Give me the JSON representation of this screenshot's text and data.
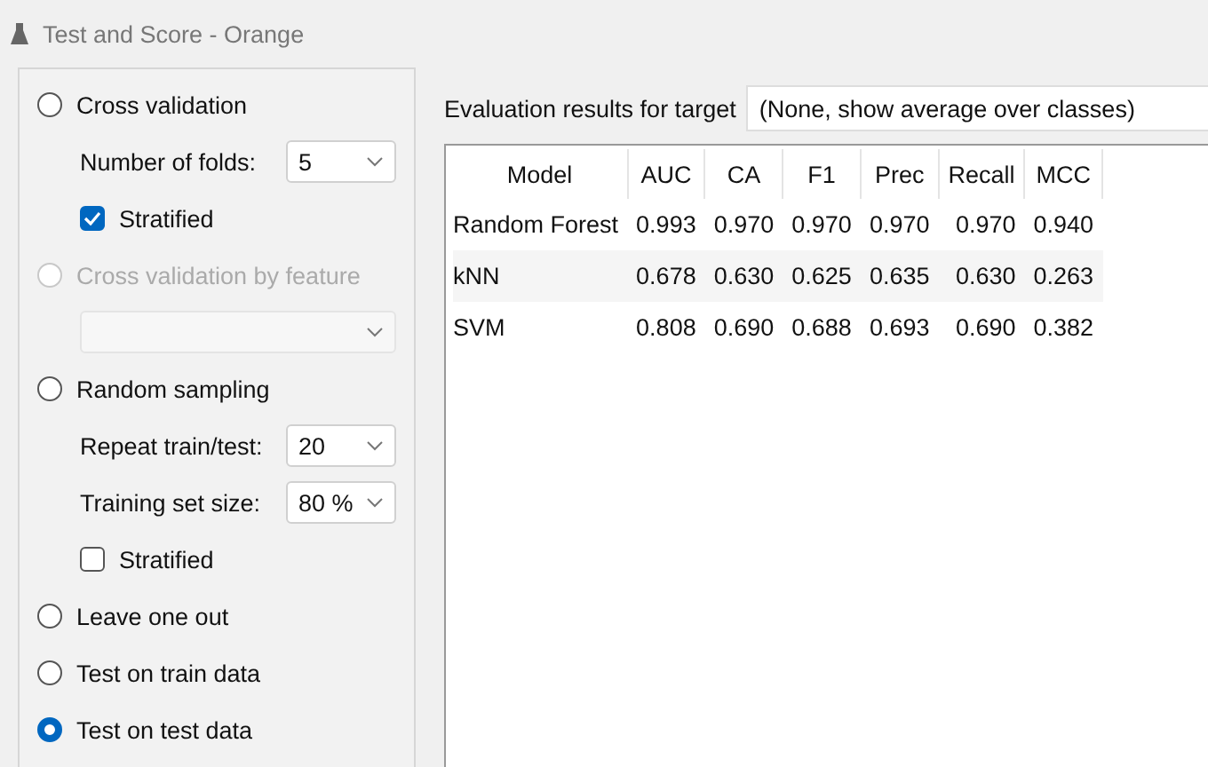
{
  "window": {
    "title": "Test and Score - Orange"
  },
  "options": [
    {
      "kind": "radio",
      "label": "Cross validation",
      "selected": false,
      "disabled": false
    },
    {
      "kind": "combo",
      "label": "Number of folds:",
      "value": "5",
      "disabled": false
    },
    {
      "kind": "checkbox",
      "label": "Stratified",
      "checked": true,
      "disabled": false
    },
    {
      "kind": "radio",
      "label": "Cross validation by feature",
      "selected": false,
      "disabled": true
    },
    {
      "kind": "combo",
      "disabled": true
    },
    {
      "kind": "radio",
      "label": "Random sampling",
      "selected": false,
      "disabled": false
    },
    {
      "kind": "combo",
      "label": "Repeat train/test:",
      "value": "20",
      "disabled": false
    },
    {
      "kind": "combo",
      "label": "Training set size:",
      "value": "80 %",
      "disabled": false
    },
    {
      "kind": "checkbox",
      "label": "Stratified",
      "checked": false,
      "disabled": false
    },
    {
      "kind": "radio",
      "label": "Leave one out",
      "selected": false,
      "disabled": false
    },
    {
      "kind": "radio",
      "label": "Test on train data",
      "selected": false,
      "disabled": false
    },
    {
      "kind": "radio",
      "label": "Test on test data",
      "selected": true,
      "disabled": false
    }
  ],
  "target": {
    "label": "Evaluation results for target",
    "value": "(None, show average over classes)"
  },
  "table": {
    "columns": [
      "Model",
      "AUC",
      "CA",
      "F1",
      "Prec",
      "Recall",
      "MCC"
    ],
    "rows": [
      [
        "Random Forest",
        "0.993",
        "0.970",
        "0.970",
        "0.970",
        "0.970",
        "0.940"
      ],
      [
        "kNN",
        "0.678",
        "0.630",
        "0.625",
        "0.635",
        "0.630",
        "0.263"
      ],
      [
        "SVM",
        "0.808",
        "0.690",
        "0.688",
        "0.693",
        "0.690",
        "0.382"
      ]
    ]
  }
}
